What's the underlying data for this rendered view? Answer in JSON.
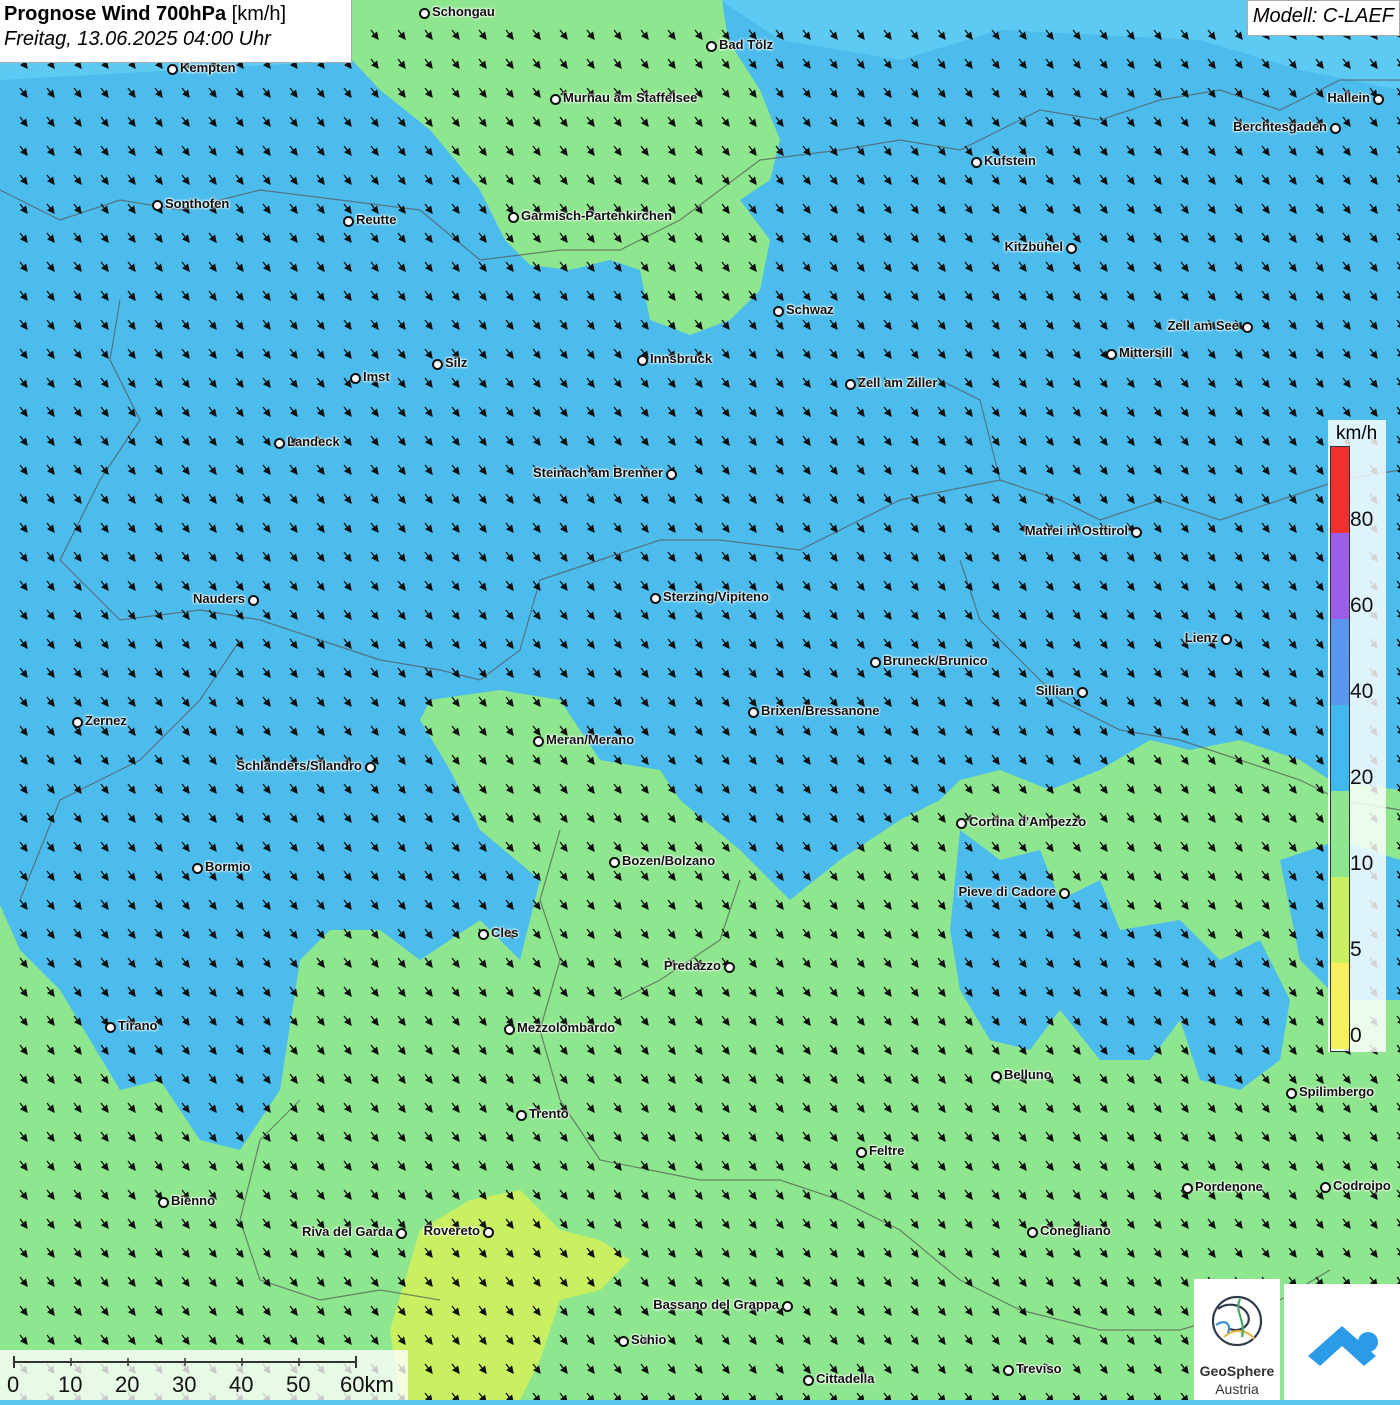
{
  "title": {
    "main": "Prognose Wind 700hPa",
    "unit": "[km/h]",
    "datetime": "Freitag, 13.06.2025 04:00 Uhr"
  },
  "model": "Modell: C-LAEF",
  "legend": {
    "unit": "km/h",
    "labels": [
      "80",
      "60",
      "40",
      "20",
      "10",
      "5",
      "0"
    ],
    "colors": [
      "#f03030",
      "#9b5ee8",
      "#5a96ee",
      "#3fb8ee",
      "#8ee68e",
      "#c8f060",
      "#f6f060"
    ]
  },
  "scale": {
    "labels": [
      "0",
      "10",
      "20",
      "30",
      "40",
      "50",
      "60km"
    ]
  },
  "logos": {
    "geosphere_line1": "GeoSphere",
    "geosphere_line2": "Austria"
  },
  "map_colors": {
    "blue_20_40": "#4cbcec",
    "blue_dark": "#3aa6e2",
    "green_10_20": "#8ee68e",
    "yellow_5_10": "#c8f060"
  },
  "cities": [
    "Schongau",
    "Bad Tölz",
    "Kempten",
    "Murnau am Staffelsee",
    "Hallein",
    "Berchtesgaden",
    "Kufstein",
    "Sonthofen",
    "Reutte",
    "Garmisch-Partenkirchen",
    "Kitzbühel",
    "Schwaz",
    "Zell am See",
    "Innsbruck",
    "Mittersill",
    "Silz",
    "Imst",
    "Zell am Ziller",
    "Landeck",
    "Steinach am Brenner",
    "Matrei in Osttirol",
    "Nauders",
    "Sterzing/Vipiteno",
    "Lienz",
    "Bruneck/Brunico",
    "Sillian",
    "Brixen/Bressanone",
    "Zernez",
    "Meran/Merano",
    "Schlanders/Silandro",
    "Cortina d'Ampezzo",
    "Bozen/Bolzano",
    "Bormio",
    "Pieve di Cadore",
    "Cles",
    "Predazzo",
    "Tirano",
    "Mezzolombardo",
    "Belluno",
    "Spilimbergo",
    "Trento",
    "Feltre",
    "Pordenone",
    "Codroipo",
    "Bienno",
    "Riva del Garda",
    "Rovereto",
    "Conegliano",
    "Bassano del Grappa",
    "Schio",
    "Treviso",
    "Cittadella"
  ]
}
